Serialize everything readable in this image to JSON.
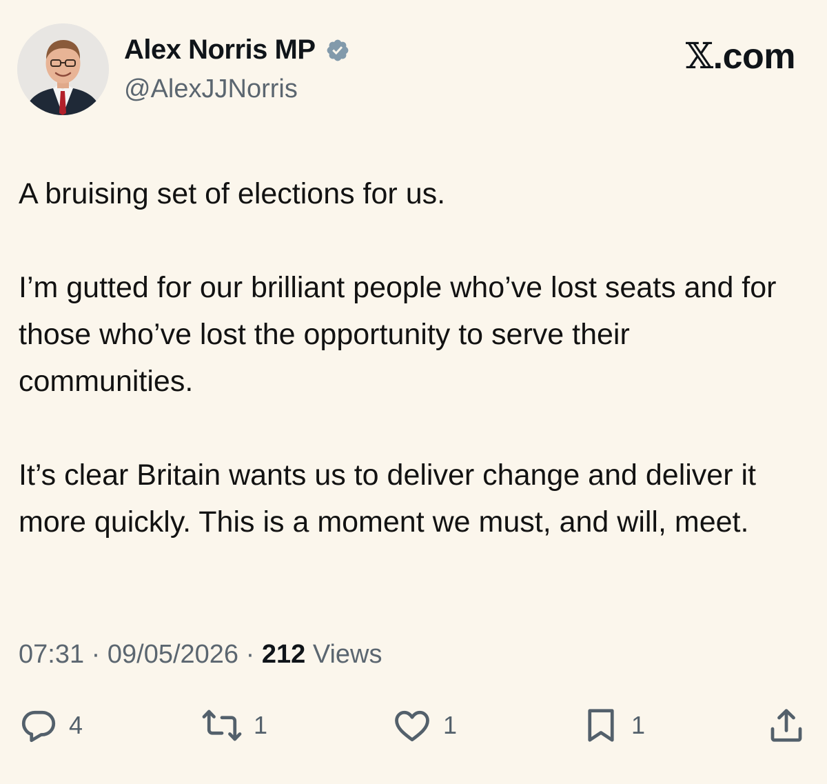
{
  "author": {
    "display_name": "Alex Norris MP",
    "handle": "@AlexJJNorris",
    "verified": true,
    "verified_badge_color": "#829aab"
  },
  "site": {
    "brand_glyph": "𝕏",
    "brand_suffix": ".com"
  },
  "tweet": {
    "paragraphs": [
      "A bruising set of elections for us.",
      "I’m gutted for our brilliant people who’ve lost seats and for those who’ve lost the opportunity to serve their communities.",
      "It’s clear Britain wants us to deliver change and deliver it more quickly. This is a moment we must, and will, meet."
    ]
  },
  "meta": {
    "time": "07:31",
    "separator": "·",
    "date": "09/05/2026",
    "views_count": "212",
    "views_label": "Views"
  },
  "actions": {
    "replies": "4",
    "reposts": "1",
    "likes": "1",
    "bookmarks": "1"
  },
  "colors": {
    "background": "#fbf6ec",
    "text": "#121212",
    "muted": "#5b6670",
    "icon": "#53606b"
  }
}
